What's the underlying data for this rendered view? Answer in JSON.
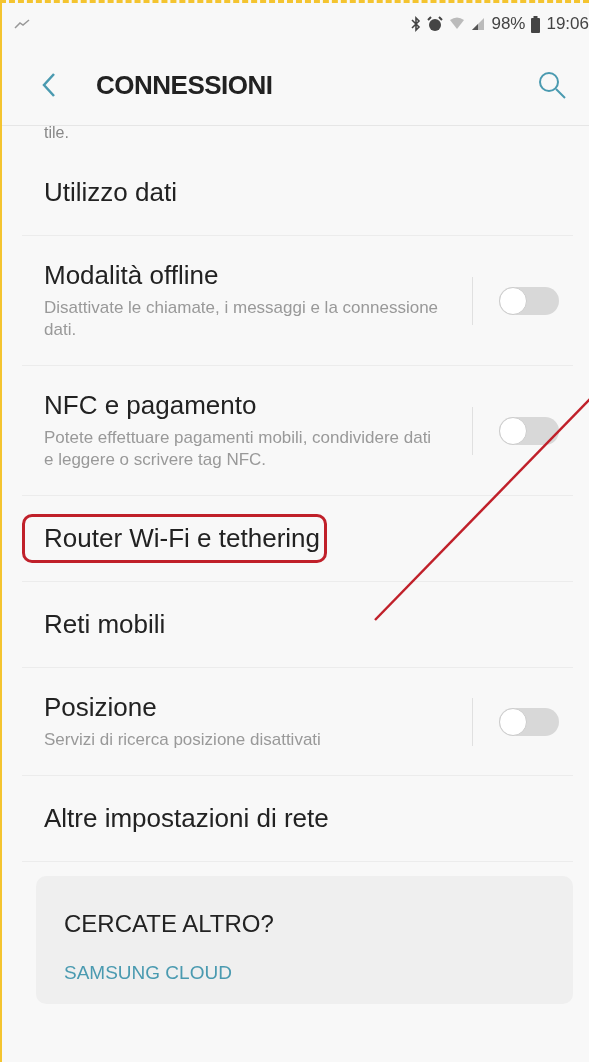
{
  "status_bar": {
    "battery": "98%",
    "time": "19:06"
  },
  "header": {
    "title": "CONNESSIONI"
  },
  "clipped_text": "tile.",
  "items": [
    {
      "kind": "plain",
      "title": "Utilizzo dati",
      "highlighted": false
    },
    {
      "kind": "switch",
      "title": "Modalità offline",
      "subtitle": "Disattivate le chiamate, i messaggi e la connessione dati.",
      "on": false,
      "highlighted": false
    },
    {
      "kind": "switch",
      "title": "NFC e pagamento",
      "subtitle": "Potete effettuare pagamenti mobili, condividere dati e leggere o scrivere tag NFC.",
      "on": false,
      "highlighted": false
    },
    {
      "kind": "plain",
      "title": "Router Wi-Fi e tethering",
      "highlighted": true
    },
    {
      "kind": "plain",
      "title": "Reti mobili",
      "highlighted": false
    },
    {
      "kind": "switch",
      "title": "Posizione",
      "subtitle": "Servizi di ricerca posizione disattivati",
      "on": false,
      "highlighted": false
    },
    {
      "kind": "plain",
      "title": "Altre impostazioni di rete",
      "highlighted": false
    }
  ],
  "suggestions": {
    "heading": "CERCATE ALTRO?",
    "links": [
      "SAMSUNG CLOUD"
    ]
  }
}
